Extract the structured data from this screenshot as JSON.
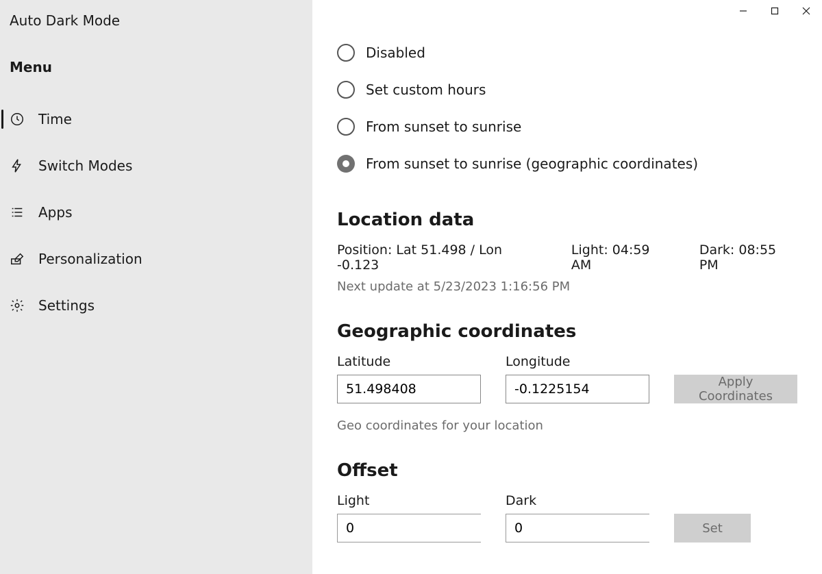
{
  "app_title": "Auto Dark Mode",
  "menu_heading": "Menu",
  "nav": [
    {
      "id": "time",
      "label": "Time",
      "icon": "clock-icon",
      "active": true
    },
    {
      "id": "switch-modes",
      "label": "Switch Modes",
      "icon": "bolt-icon",
      "active": false
    },
    {
      "id": "apps",
      "label": "Apps",
      "icon": "list-icon",
      "active": false
    },
    {
      "id": "personalization",
      "label": "Personalization",
      "icon": "paint-icon",
      "active": false
    },
    {
      "id": "settings",
      "label": "Settings",
      "icon": "gear-icon",
      "active": false
    }
  ],
  "mode_options": [
    {
      "id": "disabled",
      "label": "Disabled",
      "selected": false
    },
    {
      "id": "custom",
      "label": "Set custom hours",
      "selected": false
    },
    {
      "id": "sunset",
      "label": "From sunset to sunrise",
      "selected": false
    },
    {
      "id": "sunset-geo",
      "label": "From sunset to sunrise (geographic coordinates)",
      "selected": true
    }
  ],
  "location": {
    "heading": "Location data",
    "position": "Position: Lat 51.498 / Lon -0.123",
    "light": "Light: 04:59 AM",
    "dark": "Dark: 08:55 PM",
    "next_update_prefix": "Next update at",
    "next_update_value": "5/23/2023 1:16:56 PM"
  },
  "coords": {
    "heading": "Geographic coordinates",
    "lat_label": "Latitude",
    "lat_value": "51.498408",
    "lon_label": "Longitude",
    "lon_value": "-0.1225154",
    "apply_label": "Apply Coordinates",
    "help": "Geo coordinates for your location"
  },
  "offset": {
    "heading": "Offset",
    "light_label": "Light",
    "light_value": "0",
    "dark_label": "Dark",
    "dark_value": "0",
    "set_label": "Set"
  }
}
